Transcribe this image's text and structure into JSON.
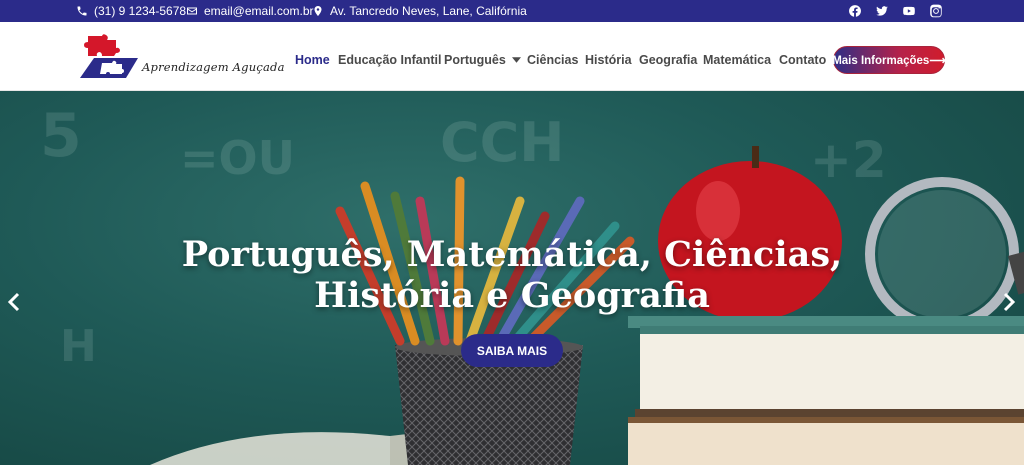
{
  "topbar": {
    "phone": "(31) 9 1234-5678",
    "email": "email@email.com.br",
    "address": "Av. Tancredo Neves, Lane, Califórnia",
    "social_icons": [
      "facebook-icon",
      "twitter-icon",
      "youtube-icon",
      "instagram-icon"
    ]
  },
  "logo": {
    "text": "Aprendizagem Aguçada"
  },
  "nav": {
    "items": [
      {
        "label": "Home",
        "active": true
      },
      {
        "label": "Educação Infantil"
      },
      {
        "label": "Português",
        "has_dropdown": true
      },
      {
        "label": "Ciências"
      },
      {
        "label": "História"
      },
      {
        "label": "Geografia"
      },
      {
        "label": "Matemática"
      },
      {
        "label": "Contato"
      }
    ],
    "cta_label": "Mais Informações⟶"
  },
  "hero": {
    "title_line1": "Português, Matemática, Ciências,",
    "title_line2": "História e Geografia",
    "button_label": "SAIBA MAIS"
  },
  "colors": {
    "brand_blue": "#2b2b8a",
    "cta_gradient_end": "#d01c2c",
    "hero_bg": "#1f5a57"
  }
}
